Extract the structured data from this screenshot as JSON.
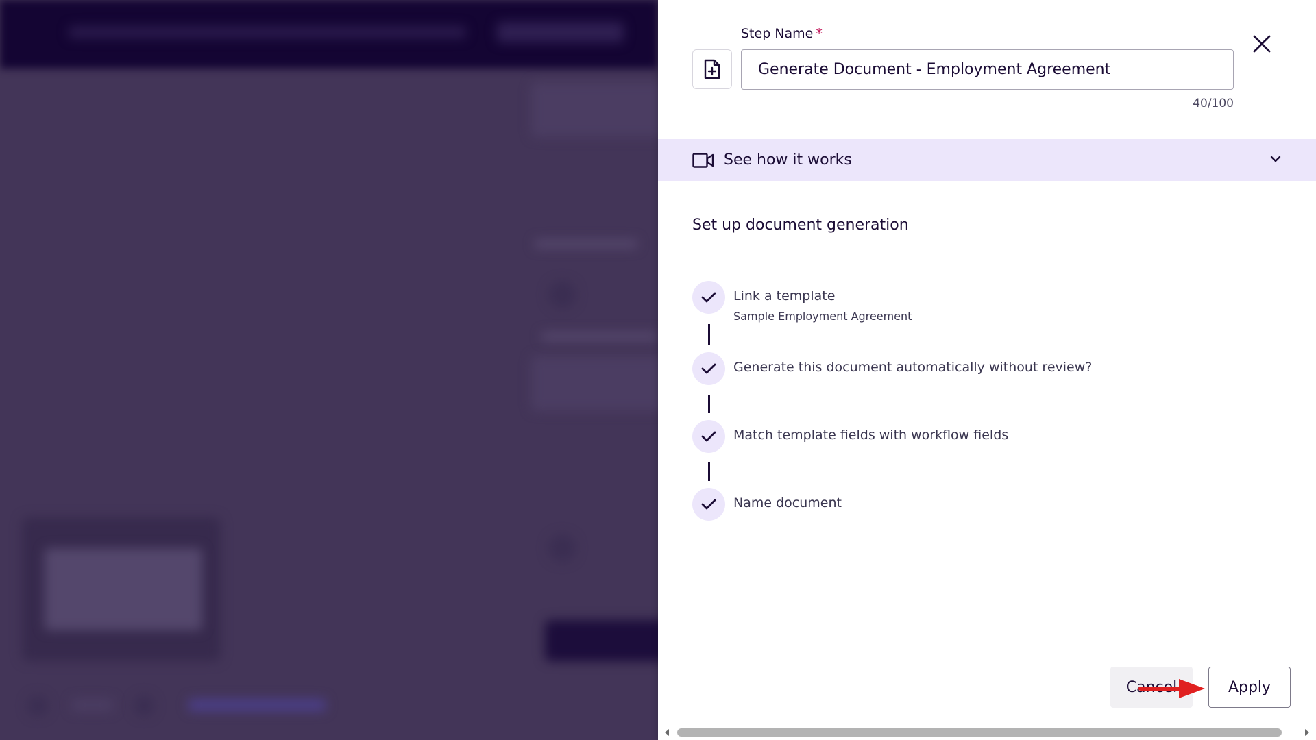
{
  "drawer": {
    "step_name_label": "Step Name",
    "required_marker": "*",
    "step_name_value": "Generate Document - Employment Agreement",
    "char_count": "40/100",
    "see_how_label": "See how it works",
    "setup_title": "Set up document generation",
    "steps": [
      {
        "title": "Link a template",
        "subtitle": "Sample Employment Agreement"
      },
      {
        "title": "Generate this document automatically without review?"
      },
      {
        "title": "Match template fields with workflow fields"
      },
      {
        "title": "Name document"
      }
    ],
    "cancel_label": "Cancel",
    "apply_label": "Apply"
  },
  "icons": {
    "doc": "file-plus-icon",
    "close": "close-icon",
    "video": "video-camera-icon",
    "chevron": "chevron-down-icon",
    "check": "check-icon",
    "arrow": "red-arrow-annotation"
  },
  "colors": {
    "primary_text": "#1b0c35",
    "band": "#ece6fb",
    "required": "#c2185b",
    "annotation_arrow": "#e02020",
    "overlay": "#433558"
  }
}
